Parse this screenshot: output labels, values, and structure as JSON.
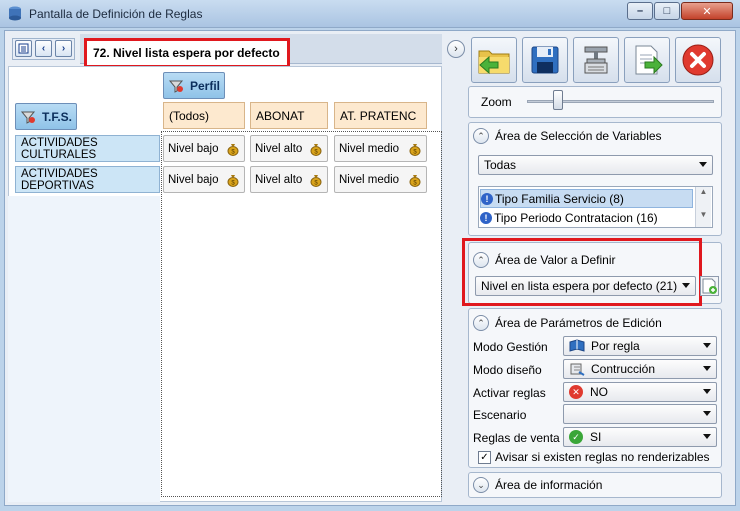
{
  "window": {
    "title": "Pantalla de Definición de Reglas",
    "minimize": "–",
    "maximize": "□",
    "close": "✕"
  },
  "document": {
    "tab_title": "72. Nivel lista espera por defecto",
    "perfil_button": "Perfil",
    "tfs_button": "T.F.S.",
    "columns": [
      "(Todos)",
      "ABONAT",
      "AT. PRATENC"
    ],
    "rows": [
      {
        "label": "ACTIVIDADES CULTURALES",
        "cells": [
          "Nivel bajo",
          "Nivel alto",
          "Nivel medio"
        ]
      },
      {
        "label": "ACTIVIDADES DEPORTIVAS",
        "cells": [
          "Nivel bajo",
          "Nivel alto",
          "Nivel medio"
        ]
      }
    ]
  },
  "right_panel": {
    "zoom_label": "Zoom",
    "zoom_value": 0.14,
    "variables_section": "Área de Selección de Variables",
    "variables_filter": "Todas",
    "variables": [
      {
        "label": "Tipo Familia Servicio (8)",
        "selected": true
      },
      {
        "label": "Tipo Periodo Contratacion (16)",
        "selected": false
      }
    ],
    "value_section": "Área de Valor a Definir",
    "value_selected": "Nivel en lista espera por defecto (21)",
    "params_section": "Área de Parámetros de Edición",
    "params": [
      {
        "label": "Modo Gestión",
        "value": "Por regla",
        "icon": "book-icon"
      },
      {
        "label": "Modo diseño",
        "value": "Contrucción",
        "icon": "tools-icon"
      },
      {
        "label": "Activar reglas",
        "value": "NO",
        "icon": "red-x-icon"
      },
      {
        "label": "Escenario",
        "value": "",
        "icon": ""
      },
      {
        "label": "Reglas de venta",
        "value": "SI",
        "icon": "green-check-icon"
      }
    ],
    "checkbox_label": "Avisar si existen reglas no renderizables",
    "checkbox_checked": true,
    "info_section": "Área de información"
  },
  "colors": {
    "highlight_red": "#e0181e",
    "header_blue": "#a6d2f0",
    "col_header": "#fde9cf"
  }
}
